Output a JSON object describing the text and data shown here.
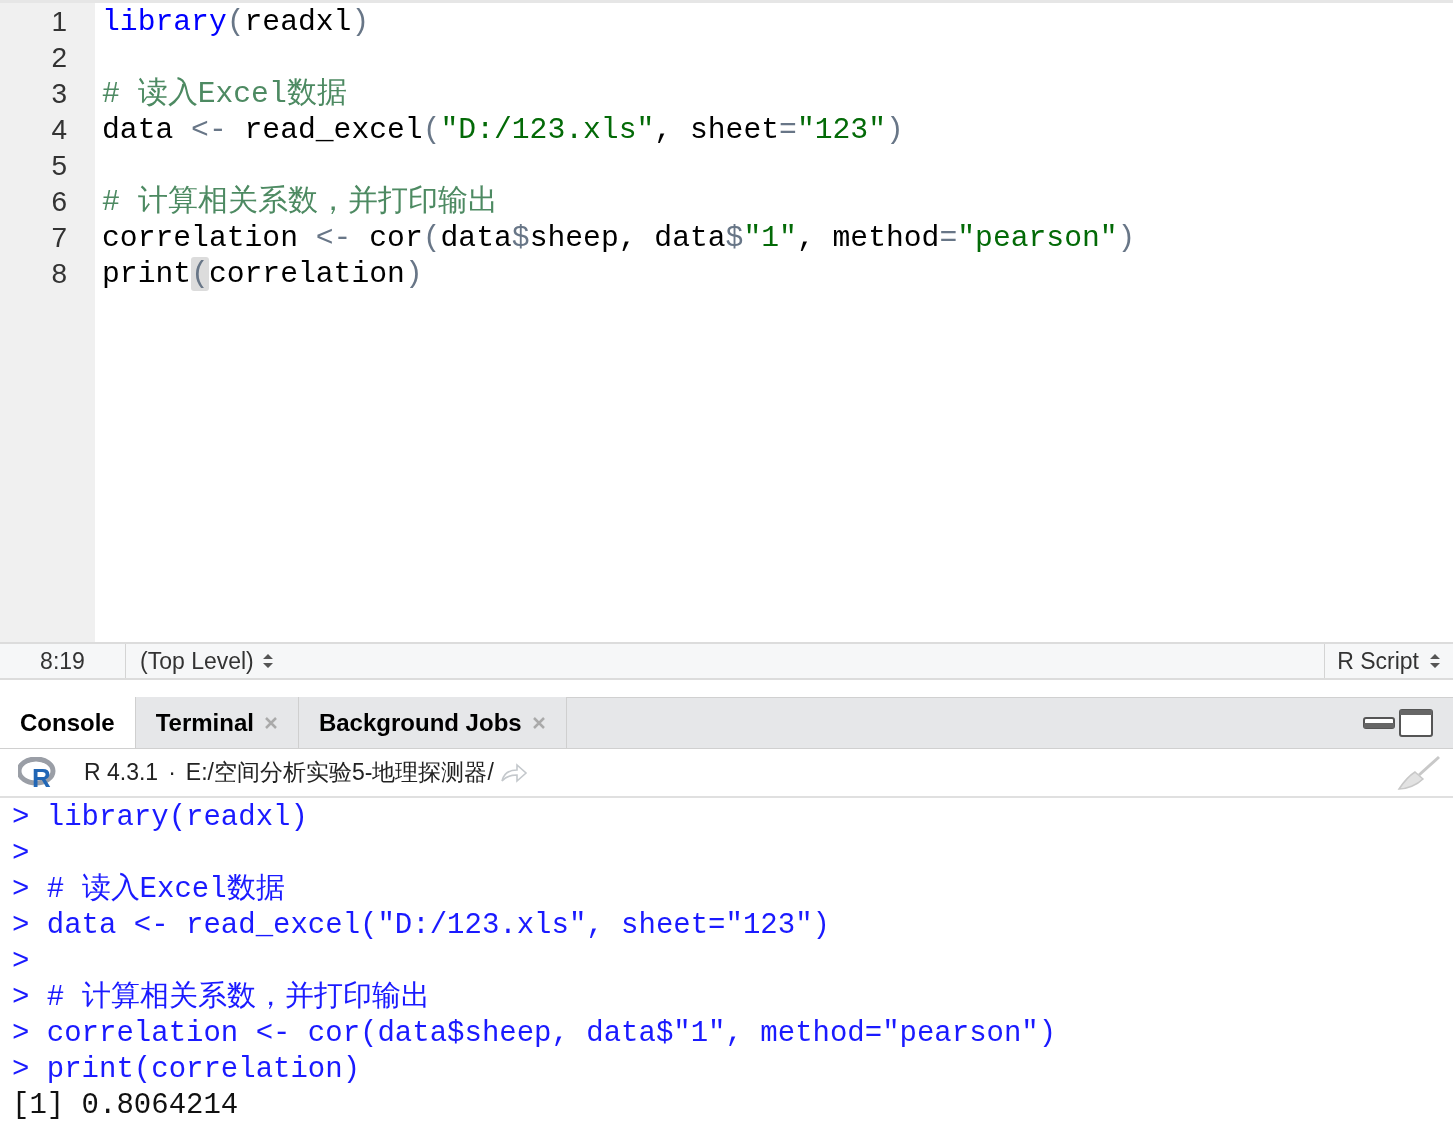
{
  "editor": {
    "lines": [
      {
        "number": "1",
        "tokens": [
          {
            "kind": "keyword",
            "text": "library"
          },
          {
            "kind": "punct",
            "text": "("
          },
          {
            "kind": "plain",
            "text": "readxl"
          },
          {
            "kind": "punct",
            "text": ")"
          }
        ]
      },
      {
        "number": "2"
      },
      {
        "number": "3",
        "tokens": [
          {
            "kind": "comment",
            "text": "# 读入Excel数据"
          }
        ]
      },
      {
        "number": "4",
        "tokens": [
          {
            "kind": "plain",
            "text": "data "
          },
          {
            "kind": "punct",
            "text": "<-"
          },
          {
            "kind": "plain",
            "text": " read_excel"
          },
          {
            "kind": "punct",
            "text": "("
          },
          {
            "kind": "string",
            "text": "\"D:/123.xls\""
          },
          {
            "kind": "plain",
            "text": ", sheet"
          },
          {
            "kind": "punct",
            "text": "="
          },
          {
            "kind": "string",
            "text": "\"123\""
          },
          {
            "kind": "punct",
            "text": ")"
          }
        ]
      },
      {
        "number": "5"
      },
      {
        "number": "6",
        "tokens": [
          {
            "kind": "comment",
            "text": "# 计算相关系数，并打印输出"
          }
        ]
      },
      {
        "number": "7",
        "tokens": [
          {
            "kind": "plain",
            "text": "correlation "
          },
          {
            "kind": "punct",
            "text": "<-"
          },
          {
            "kind": "plain",
            "text": " cor"
          },
          {
            "kind": "punct",
            "text": "("
          },
          {
            "kind": "plain",
            "text": "data"
          },
          {
            "kind": "punct",
            "text": "$"
          },
          {
            "kind": "plain",
            "text": "sheep, data"
          },
          {
            "kind": "punct",
            "text": "$"
          },
          {
            "kind": "string",
            "text": "\"1\""
          },
          {
            "kind": "plain",
            "text": ", method"
          },
          {
            "kind": "punct",
            "text": "="
          },
          {
            "kind": "string",
            "text": "\"pearson\""
          },
          {
            "kind": "punct",
            "text": ")"
          }
        ]
      },
      {
        "number": "8",
        "tokens": [
          {
            "kind": "plain",
            "text": "print"
          },
          {
            "kind": "match",
            "text": "("
          },
          {
            "kind": "plain",
            "text": "correlation"
          },
          {
            "kind": "punct",
            "text": ")"
          }
        ]
      }
    ]
  },
  "status_bar": {
    "position": "8:19",
    "scope": "(Top Level)",
    "file_type": "R Script"
  },
  "tabs": [
    {
      "label": "Console",
      "selected": true,
      "closable": false
    },
    {
      "label": "Terminal",
      "selected": false,
      "closable": true
    },
    {
      "label": "Background Jobs",
      "selected": false,
      "closable": true
    }
  ],
  "console_header": {
    "logo_letter": "R",
    "version": "R 4.3.1",
    "separator": "·",
    "path": "E:/空间分析实验5-地理探测器/"
  },
  "console": [
    {
      "kind": "input",
      "text": "> library(readxl)"
    },
    {
      "kind": "input",
      "text": ">"
    },
    {
      "kind": "input",
      "text": "> # 读入Excel数据"
    },
    {
      "kind": "input",
      "text": "> data <- read_excel(\"D:/123.xls\", sheet=\"123\")"
    },
    {
      "kind": "input",
      "text": ">"
    },
    {
      "kind": "input",
      "text": "> # 计算相关系数，并打印输出"
    },
    {
      "kind": "input",
      "text": "> correlation <- cor(data$sheep, data$\"1\", method=\"pearson\")"
    },
    {
      "kind": "input",
      "text": "> print(correlation)"
    },
    {
      "kind": "output",
      "text": "[1] 0.8064214"
    }
  ]
}
